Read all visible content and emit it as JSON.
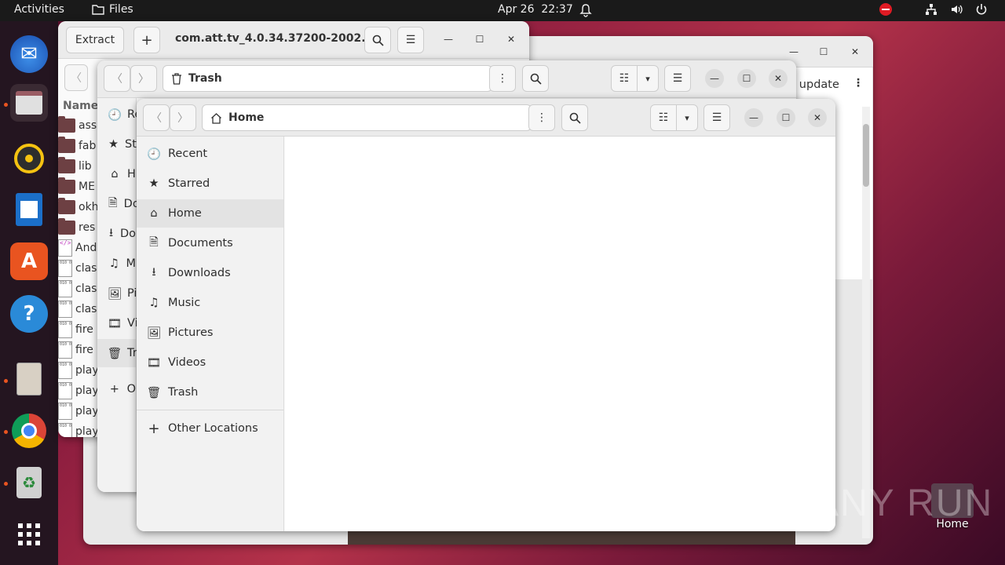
{
  "topbar": {
    "activities": "Activities",
    "app_name": "Files",
    "date": "Apr 26",
    "time": "22:37"
  },
  "dock": {
    "apps": [
      "thunderbird-icon",
      "files-icon",
      "rhythmbox-icon",
      "writer-icon",
      "app-center-icon",
      "help-icon",
      "archive-icon",
      "chrome-icon",
      "recycle-bin-icon",
      "app-grid-icon"
    ]
  },
  "archive_window": {
    "extract_label": "Extract",
    "title": "com.att.tv_4.0.34.37200-2002...",
    "column_name": "Name",
    "files": [
      "ass",
      "fab",
      "lib",
      "ME",
      "okh",
      "res",
      "And",
      "clas",
      "clas",
      "clas",
      "fire",
      "fire",
      "play",
      "play",
      "play",
      "play"
    ]
  },
  "bg_window": {
    "update_label": "h update"
  },
  "trash_window": {
    "path_label": "Trash",
    "sidebar": [
      "Re",
      "St",
      "H",
      "Do",
      "Do",
      "M",
      "Pi",
      "Vi",
      "Tr",
      "O"
    ]
  },
  "home_window": {
    "path_label": "Home",
    "sidebar": [
      {
        "label": "Recent",
        "icon": "clock-icon"
      },
      {
        "label": "Starred",
        "icon": "star-icon"
      },
      {
        "label": "Home",
        "icon": "home-icon"
      },
      {
        "label": "Documents",
        "icon": "document-icon"
      },
      {
        "label": "Downloads",
        "icon": "download-icon"
      },
      {
        "label": "Music",
        "icon": "music-icon"
      },
      {
        "label": "Pictures",
        "icon": "picture-icon"
      },
      {
        "label": "Videos",
        "icon": "video-icon"
      },
      {
        "label": "Trash",
        "icon": "trash-icon"
      }
    ],
    "other_locations": "Other Locations"
  },
  "desktop": {
    "home_label": "Home",
    "watermark": "ANY RUN"
  }
}
